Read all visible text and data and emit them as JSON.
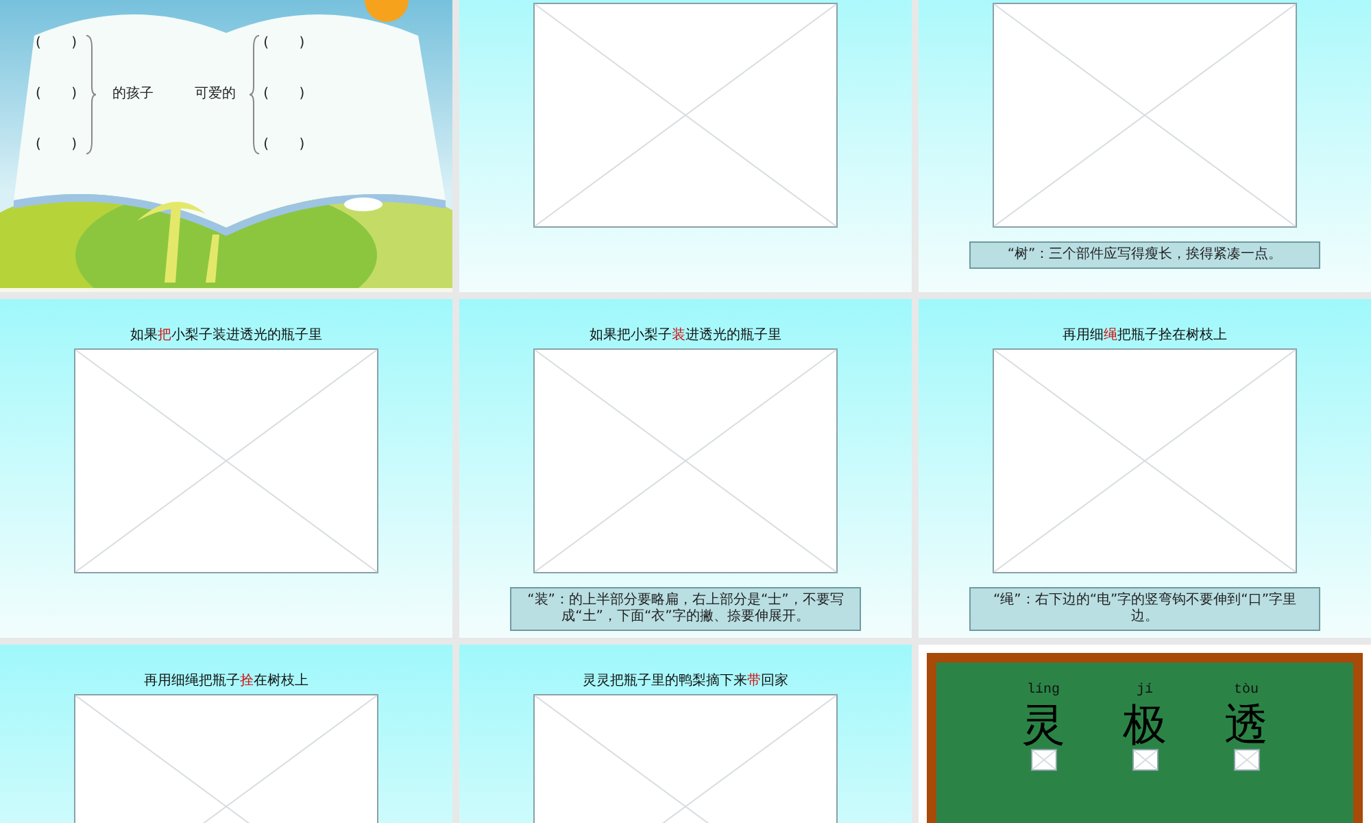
{
  "slides": [
    {
      "kind": "book",
      "left_blanks": [
        "(       )",
        "(       )",
        "(       )"
      ],
      "left_word": "的孩子",
      "right_word": "可爱的",
      "right_blanks": [
        "(       )",
        "(       )",
        "(       )"
      ]
    },
    {
      "kind": "lesson"
    },
    {
      "kind": "lesson",
      "note": "“树”：三个部件应写得瘦长，挨得紧凑一点。"
    },
    {
      "kind": "lesson",
      "title": {
        "before": "如果",
        "mark": "把",
        "after": "小梨子装进透光的瓶子里"
      }
    },
    {
      "kind": "lesson",
      "title": {
        "before": "如果把小梨子",
        "mark": "装",
        "after": "进透光的瓶子里"
      },
      "note": "“装”：的上半部分要略扁，右上部分是“士”，不要写成“土”，下面“衣”字的撇、捺要伸展开。"
    },
    {
      "kind": "lesson",
      "title": {
        "before": "再用细",
        "mark": "绳",
        "after": "把瓶子拴在树枝上"
      },
      "note": "“绳”：右下边的“电”字的竖弯钩不要伸到“口”字里边。"
    },
    {
      "kind": "lesson",
      "title": {
        "before": "再用细绳把瓶子",
        "mark": "拴",
        "after": "在树枝上"
      }
    },
    {
      "kind": "lesson",
      "title": {
        "before": "灵灵把瓶子里的鸭梨摘下来",
        "mark": "带",
        "after": "回家"
      }
    },
    {
      "kind": "board",
      "words": [
        {
          "pinyin": "líng",
          "hanzi": "灵"
        },
        {
          "pinyin": "jí",
          "hanzi": "极"
        },
        {
          "pinyin": "tòu",
          "hanzi": "透"
        }
      ]
    }
  ]
}
